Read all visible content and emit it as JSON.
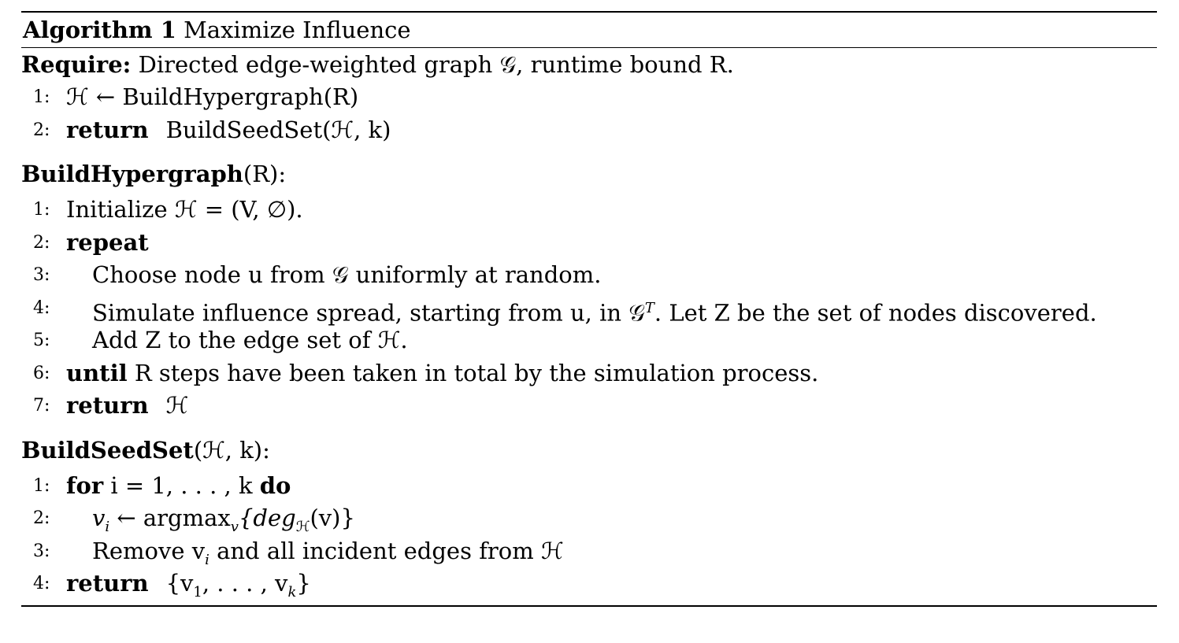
{
  "algorithm": {
    "label": "Algorithm 1",
    "name": "Maximize Influence",
    "require_label": "Require:",
    "require_text": "Directed edge-weighted graph 𝒢, runtime bound R.",
    "main_lines": [
      {
        "num": "1:",
        "text": "ℋ ← BuildHypergraph(R)"
      },
      {
        "num": "2:",
        "keyword": "return",
        "text": "BuildSeedSet(ℋ, k)"
      }
    ]
  },
  "build_hypergraph": {
    "header_bold": "BuildHypergraph",
    "header_rest": "(R):",
    "lines": [
      {
        "num": "1:",
        "text": "Initialize ℋ = (V, ∅)."
      },
      {
        "num": "2:",
        "keyword": "repeat"
      },
      {
        "num": "3:",
        "text": "Choose node u from 𝒢 uniformly at random."
      },
      {
        "num": "4:",
        "text": "Simulate influence spread, starting from u, in 𝒢",
        "sup": "T",
        "text_after": ". Let Z be the set of nodes discovered."
      },
      {
        "num": "5:",
        "text": "Add Z to the edge set of ℋ."
      },
      {
        "num": "6:",
        "keyword": "until",
        "text": "R steps have been taken in total by the simulation process."
      },
      {
        "num": "7:",
        "keyword": "return",
        "text": "ℋ"
      }
    ]
  },
  "build_seedset": {
    "header_bold": "BuildSeedSet",
    "header_rest": "(ℋ, k):",
    "lines": [
      {
        "num": "1:",
        "keyword": "for",
        "text": "i = 1, . . . , k",
        "keyword_after": "do"
      },
      {
        "num": "2:",
        "text": "v",
        "sub": "i",
        "text_after": " ← argmax",
        "sub2": "v",
        "text_after2": "{deg",
        "sub3": "ℋ",
        "text_after3": "(v)}"
      },
      {
        "num": "3:",
        "text": "Remove v",
        "sub": "i",
        "text_after": " and all incident edges from ℋ"
      },
      {
        "num": "4:",
        "keyword": "return",
        "text": "{v",
        "sub": "1",
        "text_after": ", . . . , v",
        "sub2": "k",
        "text_after2": "}"
      }
    ]
  }
}
